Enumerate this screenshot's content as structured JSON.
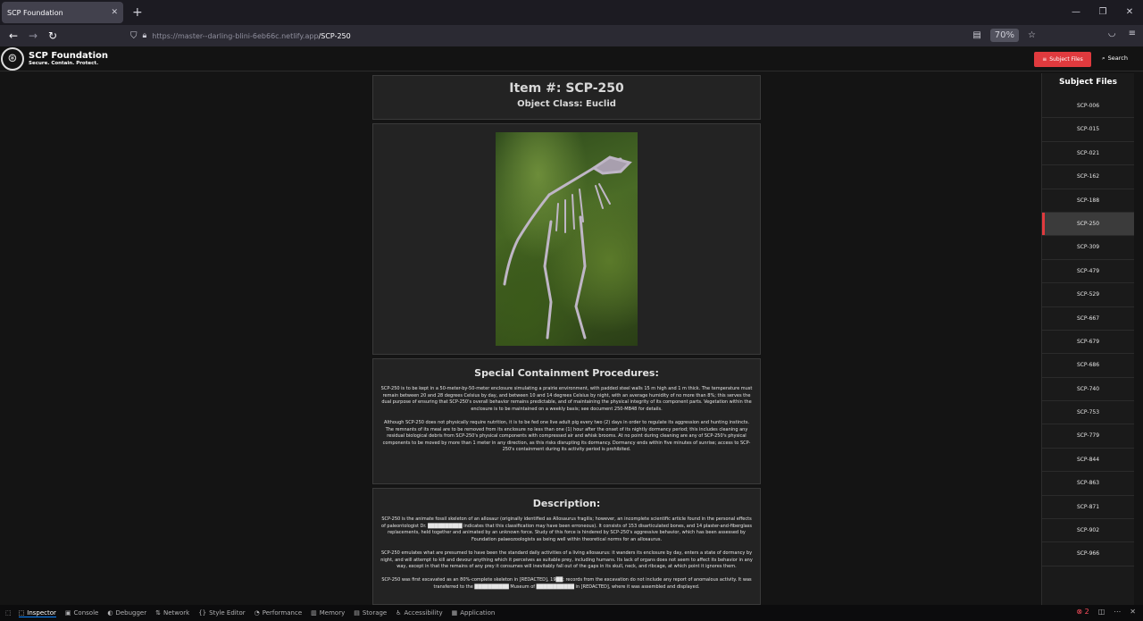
{
  "browser": {
    "tab_title": "SCP Foundation",
    "url_host": "https://master--darling-blini-6eb66c.netlify.app",
    "url_path": "/SCP-250",
    "zoom": "70%"
  },
  "site": {
    "brand_name": "SCP Foundation",
    "brand_tagline": "Secure. Contain. Protect.",
    "subject_files_button": "Subject Files",
    "search_button": "Search"
  },
  "article": {
    "item_title": "Item #: SCP-250",
    "object_class": "Object Class: Euclid",
    "containment_title": "Special Containment Procedures:",
    "containment_paras": [
      "SCP-250 is to be kept in a 50-meter-by-50-meter enclosure simulating a prairie environment, with padded steel walls 15 m high and 1 m thick. The temperature must remain between 20 and 28 degrees Celsius by day, and between 10 and 14 degrees Celsius by night, with an average humidity of no more than 8%; this serves the dual purpose of ensuring that SCP-250's overall behavior remains predictable, and of maintaining the physical integrity of its component parts. Vegetation within the enclosure is to be maintained on a weekly basis; see document 250-MB48 for details.",
      "Although SCP-250 does not physically require nutrition, it is to be fed one live adult pig every two (2) days in order to regulate its aggression and hunting instincts. The remnants of its meal are to be removed from its enclosure no less than one (1) hour after the onset of its nightly dormancy period; this includes cleaning any residual biological debris from SCP-250's physical components with compressed air and whisk brooms. At no point during cleaning are any of SCP-250's physical components to be moved by more than 1 meter in any direction, as this risks disrupting its dormancy. Dormancy ends within five minutes of sunrise; access to SCP-250's containment during its activity period is prohibited."
    ],
    "description_title": "Description:",
    "description_paras": [
      "SCP-250 is the animate fossil skeleton of an allosaur (originally identified as Allosaurus fragilis; however, an incomplete scientific article found in the personal effects of paleontologist Dr. ██████████ indicates that this classification may have been erroneous). It consists of 153 disarticulated bones, and 14 plaster-and-fiberglass replacements, held together and animated by an unknown force. Study of this force is hindered by SCP-250's aggressive behavior, which has been assessed by Foundation palaeozoologists as being well within theoretical norms for an allosaurus.",
      "SCP-250 emulates what are presumed to have been the standard daily activities of a living allosaurus: it wanders its enclosure by day, enters a state of dormancy by night, and will attempt to kill and devour anything which it perceives as suitable prey, including humans. Its lack of organs does not seem to affect its behavior in any way, except in that the remains of any prey it consumes will inevitably fall out of the gaps in its skull, neck, and ribcage, at which point it ignores them.",
      "SCP-250 was first excavated as an 80%-complete skeleton in [REDACTED], 19██; records from the excavation do not include any report of anomalous activity. It was transferred to the ██████████ Museum of ███████████ in [REDACTED], where it was assembled and displayed."
    ]
  },
  "sidebar": {
    "title": "Subject Files",
    "items": [
      "SCP-006",
      "SCP-015",
      "SCP-021",
      "SCP-162",
      "SCP-188",
      "SCP-250",
      "SCP-309",
      "SCP-479",
      "SCP-529",
      "SCP-667",
      "SCP-679",
      "SCP-686",
      "SCP-740",
      "SCP-753",
      "SCP-779",
      "SCP-844",
      "SCP-863",
      "SCP-871",
      "SCP-902",
      "SCP-966"
    ],
    "active": "SCP-250"
  },
  "devtools": {
    "tools": [
      "Inspector",
      "Console",
      "Debugger",
      "Network",
      "Style Editor",
      "Performance",
      "Memory",
      "Storage",
      "Accessibility",
      "Application"
    ],
    "error_count": "2"
  },
  "colors": {
    "accent": "#e03a3e",
    "page_bg": "#141414",
    "card_bg": "#232323"
  }
}
